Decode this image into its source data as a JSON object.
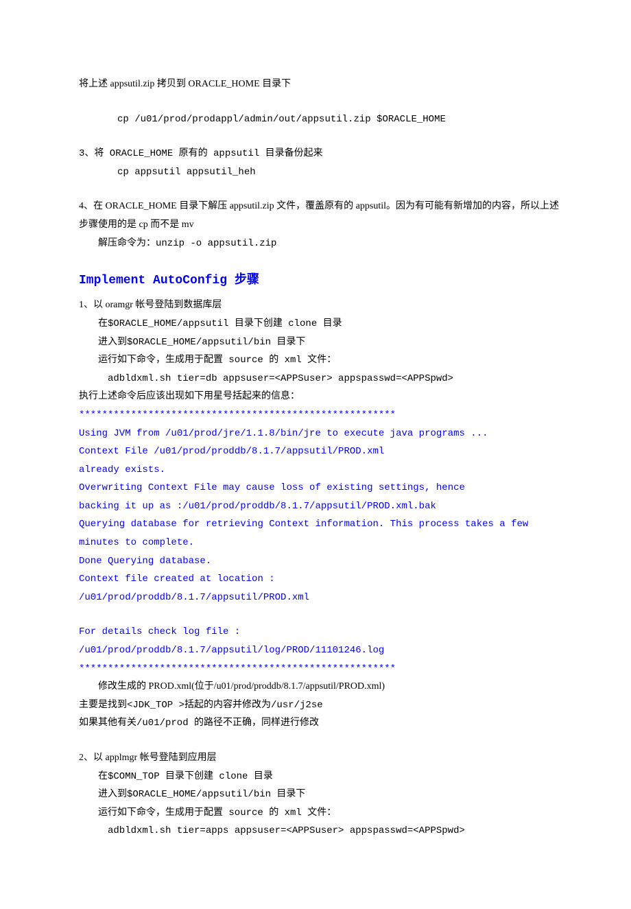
{
  "p1": "将上述 appsutil.zip 拷贝到 ORACLE_HOME 目录下",
  "p2": "cp /u01/prod/prodappl/admin/out/appsutil.zip $ORACLE_HOME",
  "p3": "3、将 ORACLE_HOME 原有的 appsutil 目录备份起来",
  "p4": "cp appsutil appsutil_heh",
  "p5": "4、在 ORACLE_HOME 目录下解压 appsutil.zip 文件，覆盖原有的 appsutil。因为有可能有新增加的内容，所以上述步骤使用的是 cp 而不是 mv",
  "p6": "解压命令为：unzip -o appsutil.zip",
  "heading": "Implement AutoConfig 步骤",
  "s1_l1": "1、以 oramgr 帐号登陆到数据库层",
  "s1_l2": "在$ORACLE_HOME/appsutil 目录下创建 clone 目录",
  "s1_l3": "进入到$ORACLE_HOME/appsutil/bin 目录下",
  "s1_l4": "运行如下命令，生成用于配置 source 的 xml 文件：",
  "s1_l5": "adbldxml.sh tier=db appsuser=<APPSuser> appspasswd=<APPSpwd>",
  "s1_l6": "执行上述命令后应该出现如下用星号括起来的信息：",
  "stars": "*******************************************************",
  "b1": "Using JVM from /u01/prod/jre/1.1.8/bin/jre to execute java programs ...",
  "b2": "Context File  /u01/prod/proddb/8.1.7/appsutil/PROD.xml",
  "b3": "already exists.",
  "b4": "Overwriting Context File may cause loss of existing settings, hence",
  "b5": "backing it up as :/u01/prod/proddb/8.1.7/appsutil/PROD.xml.bak",
  "b6": "Querying database for retrieving Context information. This process takes a few minutes to complete.",
  "b7": "Done Querying database.",
  "b8": "Context file created at location :",
  "b9": "/u01/prod/proddb/8.1.7/appsutil/PROD.xml",
  "b10": "For details check log file :",
  "b11": "/u01/prod/proddb/8.1.7/appsutil/log/PROD/11101246.log",
  "after1": "修改生成的 PROD.xml(位于/u01/prod/proddb/8.1.7/appsutil/PROD.xml)",
  "after2": "主要是找到<JDK_TOP   >括起的内容并修改为/usr/j2se",
  "after3": "如果其他有关/u01/prod 的路径不正确，同样进行修改",
  "s2_l1": "2、以 applmgr 帐号登陆到应用层",
  "s2_l2": "在$COMN_TOP 目录下创建 clone 目录",
  "s2_l3": "进入到$ORACLE_HOME/appsutil/bin 目录下",
  "s2_l4": "运行如下命令，生成用于配置 source 的 xml 文件：",
  "s2_l5": "adbldxml.sh tier=apps appsuser=<APPSuser> appspasswd=<APPSpwd>"
}
